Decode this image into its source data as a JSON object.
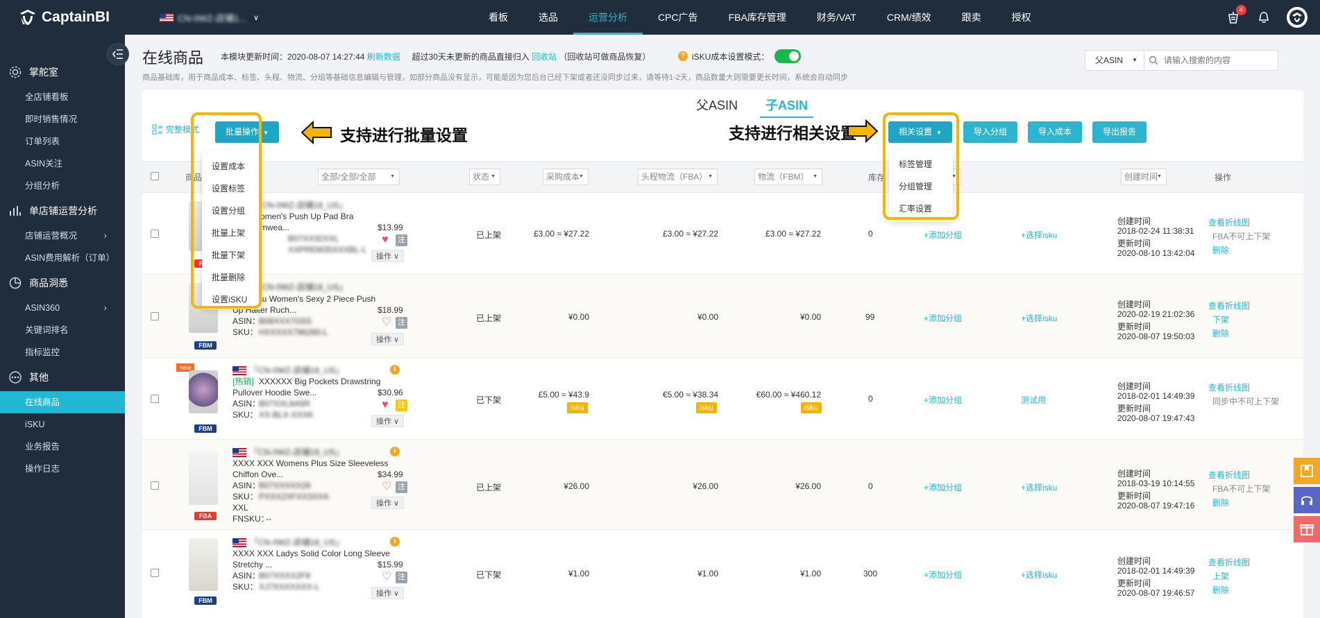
{
  "brand": {
    "name": "CaptainBI"
  },
  "store": {
    "name": "CN-0WZ-店铺1..."
  },
  "nav": [
    {
      "label": "看板",
      "active": false
    },
    {
      "label": "选品",
      "active": false
    },
    {
      "label": "运营分析",
      "active": true
    },
    {
      "label": "CPC广告",
      "active": false
    },
    {
      "label": "FBA库存管理",
      "active": false
    },
    {
      "label": "财务/VAT",
      "active": false
    },
    {
      "label": "CRM/绩效",
      "active": false
    },
    {
      "label": "跟卖",
      "active": false
    },
    {
      "label": "授权",
      "active": false
    }
  ],
  "notifications": {
    "count": "4"
  },
  "sidebar": {
    "groups": [
      {
        "label": "掌舵室",
        "icon": "gear-icon"
      },
      {
        "label": "单店铺运营分析",
        "icon": "bar-chart-icon"
      },
      {
        "label": "商品洞悉",
        "icon": "pie-chart-icon"
      },
      {
        "label": "其他",
        "icon": "more-icon"
      }
    ],
    "items_g1": [
      "全店铺看板",
      "即时销售情况",
      "订单列表",
      "ASIN关注",
      "分组分析"
    ],
    "items_g2": [
      "店铺运营概况",
      "ASIN费用解析（订单）"
    ],
    "items_g3": [
      "ASIN360",
      "关键词排名",
      "指标监控"
    ],
    "items_g4": [
      "在线商品",
      "iSKU",
      "业务报告",
      "操作日志"
    ]
  },
  "page": {
    "title": "在线商品",
    "update_prefix": "本模块更新时间：2020-08-07 14:27:44",
    "refresh_link": "刷新数据",
    "archive_prefix": "超过30天未更新的商品直接归入",
    "recycle_link": "回收站",
    "archive_suffix": "（回收站可做商品恢复）",
    "isku_mode_label": "iSKU成本设置模式：",
    "description": "商品基础库，用于商品成本、标签、头程、物流、分组等基础信息编辑与管理，如部分商品没有显示，可能是因为您后台已经下架或者还没同步过来，请等待1-2天，商品数量大则需要更长时间，系统会自动同步"
  },
  "search": {
    "select": "父ASIN",
    "placeholder": "请输入搜索的内容"
  },
  "tabs": [
    "父ASIN",
    "子ASIN"
  ],
  "toolbar": {
    "full_mode": "完整模式",
    "bulk_ops": "批量操作",
    "related_settings": "相关设置",
    "import_group": "导入分组",
    "import_cost": "导入成本",
    "export_report": "导出报告"
  },
  "callouts": {
    "left": "支持进行批量设置",
    "right": "支持进行相关设置"
  },
  "bulk_menu": [
    "设置成本",
    "设置标签",
    "设置分组",
    "批量上架",
    "批量下架",
    "批量删除",
    "设置iSKU"
  ],
  "settings_menu": [
    "标签管理",
    "分组管理",
    "汇率设置"
  ],
  "table": {
    "headers": {
      "product_info": "商品信息",
      "filter": "全部/全部/全部",
      "status": "状态",
      "purchase_cost": "采购成本",
      "first_leg": "头程物流（FBA）",
      "fbm_logistics": "物流（FBM）",
      "stock": "库存",
      "group": "分组",
      "created": "创建时间",
      "action": "操作"
    },
    "rows": [
      {
        "ship": "FBA",
        "is_new": false,
        "store": "「CN-0WZ-店铺18_US」",
        "title1": "...omen's Push Up Pad Bra",
        "title2": "...mwea...",
        "hot": "",
        "price": "$13.99",
        "asin": "B07XX32XXL",
        "sku": "XXPREM35XXXBL-L",
        "fnsku": "",
        "heart": "filled",
        "zhu_yellow": false,
        "status": "已上架",
        "purchase": "£3.00 ≈ ¥27.22",
        "first_leg": "£3.00 ≈ ¥27.22",
        "fbm": "£3.00 ≈ ¥27.22",
        "isku_tags": false,
        "stock": "0",
        "group_link": "+添加分组",
        "isku_link": "+选择isku",
        "created_label": "创建时间",
        "created": "2018-02-24 11:38:31",
        "updated_label": "更新时间",
        "updated": "2020-08-10 13:42:04",
        "act1": "查看折线图",
        "act2": "FBA不可上下架",
        "act3": "删除",
        "act2_link": false
      },
      {
        "ship": "FBM",
        "is_new": false,
        "store": "「CN-0WZ-店铺18_US」",
        "title1": "LaSuNcu Women's Sexy 2 Piece Push",
        "title2": "Up Halter Ruch...",
        "hot": "",
        "price": "$18.99",
        "asin": "B08XXX7G5S",
        "sku": "HXXXXX796280-L",
        "fnsku": "",
        "heart": "outline",
        "zhu_yellow": false,
        "status": "已上架",
        "purchase": "¥0.00",
        "first_leg": "¥0.00",
        "fbm": "¥0.00",
        "isku_tags": false,
        "stock": "99",
        "group_link": "+添加分组",
        "isku_link": "+选择isku",
        "created_label": "创建时间",
        "created": "2020-02-19 21:02:36",
        "updated_label": "更新时间",
        "updated": "2020-08-07 19:50:03",
        "act1": "查看折线图",
        "act2": "下架",
        "act3": "删除",
        "act2_link": true
      },
      {
        "ship": "FBM",
        "is_new": true,
        "store": "「CN-0WZ-店铺18_US」",
        "title1": "XXXXXX Big Pockets Drawstring",
        "title2": "Pullover Hoodie Swe...",
        "hot": "[热销]",
        "price": "$30.96",
        "asin": "B07XXL6A5R",
        "sku": "XX-BLX-XXXK",
        "fnsku": "",
        "heart": "filled",
        "zhu_yellow": true,
        "status": "已下架",
        "purchase": "£5.00 ≈ ¥43.9",
        "first_leg": "€5.00 ≈ ¥38.34",
        "fbm": "€60.00 ≈ ¥460.12",
        "isku_tags": true,
        "stock": "0",
        "group_link": "+添加分组",
        "isku_link": "测试用",
        "created_label": "创建时间",
        "created": "2018-02-01 14:49:39",
        "updated_label": "更新时间",
        "updated": "2020-08-07 19:47:43",
        "act1": "查看折线图",
        "act2": "同步中不可上下架",
        "act3": "",
        "act2_link": false
      },
      {
        "ship": "FBA",
        "is_new": false,
        "store": "「CN-0WZ-店铺18_US」",
        "title1": "XXXX XXX Womens Plus Size Sleeveless",
        "title2": "Chiffon Ove...",
        "hot": "",
        "price": "$34.99",
        "asin": "B07XXXXX26",
        "sku": "PXXX2XFXX3XX4-",
        "sku2": "XXL",
        "fnsku": "--",
        "heart": "outline",
        "zhu_yellow": false,
        "status": "已上架",
        "purchase": "¥26.00",
        "first_leg": "¥26.00",
        "fbm": "¥26.00",
        "isku_tags": false,
        "stock": "0",
        "group_link": "+添加分组",
        "isku_link": "+选择isku",
        "created_label": "创建时间",
        "created": "2018-03-19 10:14:55",
        "updated_label": "更新时间",
        "updated": "2020-08-07 19:47:16",
        "act1": "查看折线图",
        "act2": "FBA不可上下架",
        "act3": "删除",
        "act2_link": false
      },
      {
        "ship": "FBM",
        "is_new": false,
        "store": "「CN-0WZ-店铺18_US」",
        "title1": "XXXX XXX Ladys Solid Color Long Sleeve",
        "title2": "Stretchy ...",
        "hot": "",
        "price": "$15.99",
        "asin": "B07XXXX2F9",
        "sku": "XJ7XXXXXXX-L",
        "fnsku": "",
        "heart": "outline",
        "zhu_yellow": false,
        "status": "已下架",
        "purchase": "¥1.00",
        "first_leg": "¥1.00",
        "fbm": "¥1.00",
        "isku_tags": false,
        "stock": "300",
        "group_link": "+添加分组",
        "isku_link": "+选择isku",
        "created_label": "创建时间",
        "created": "2018-02-01 14:49:39",
        "updated_label": "更新时间",
        "updated": "2020-08-07 19:46:57",
        "act1": "查看折线图",
        "act2": "上架",
        "act3": "删除",
        "act2_link": true
      }
    ],
    "labels": {
      "asin": "ASIN：",
      "sku": "SKU：",
      "fnsku": "FNSKU：",
      "zhu": "注",
      "op": "操作 ∨",
      "isku_tag": "isku",
      "new": "new",
      "info": "i"
    }
  },
  "colors": {
    "accent": "#21b8d6",
    "nav_bg": "#1f2d3d",
    "highlight": "#f7b500",
    "badge": "#f03d3d"
  }
}
